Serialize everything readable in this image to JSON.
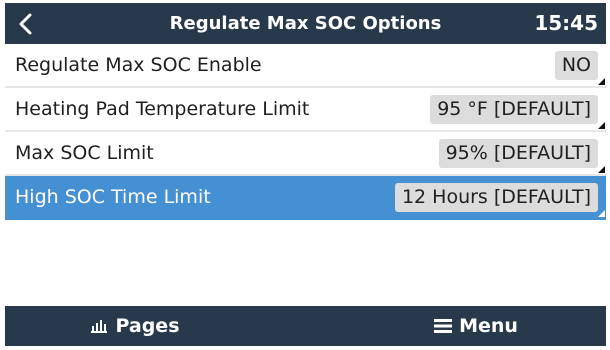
{
  "header": {
    "back_icon": "chevron-left-icon",
    "title": "Regulate Max SOC Options",
    "time": "15:45"
  },
  "settings": [
    {
      "label": "Regulate Max SOC Enable",
      "value": "NO",
      "selected": false
    },
    {
      "label": "Heating Pad Temperature Limit",
      "value": "95 °F [DEFAULT]",
      "selected": false
    },
    {
      "label": "Max SOC Limit",
      "value": "95% [DEFAULT]",
      "selected": false
    },
    {
      "label": "High SOC Time Limit",
      "value": "12 Hours [DEFAULT]",
      "selected": true
    }
  ],
  "footer": {
    "pages_icon": "bar-chart-icon",
    "pages_label": "Pages",
    "menu_icon": "menu-icon",
    "menu_label": "Menu"
  },
  "colors": {
    "header_bg": "#27394a",
    "selected_row": "#458fd3",
    "value_box": "#dcdcdc"
  }
}
